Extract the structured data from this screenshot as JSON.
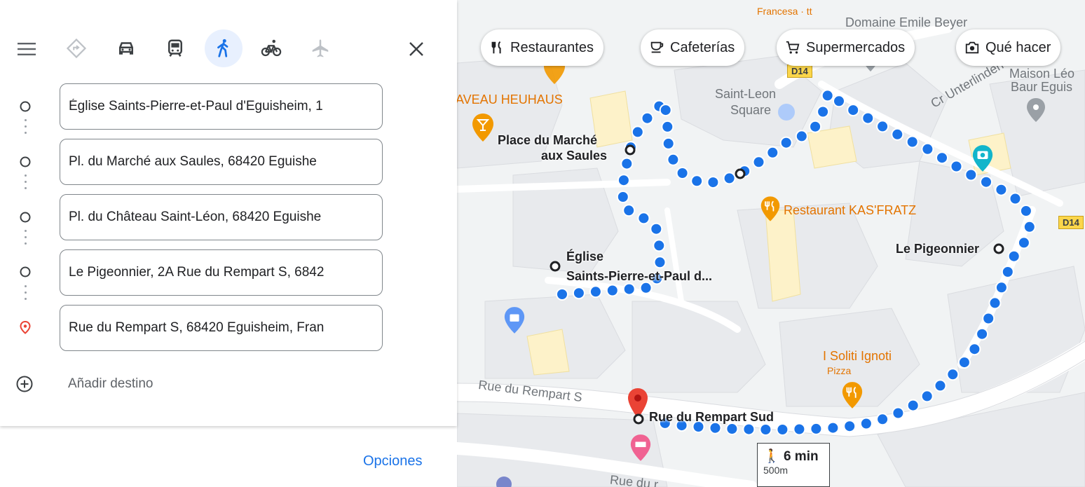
{
  "panel": {
    "menu_icon": "hamburger-menu-icon",
    "modes": [
      {
        "id": "best",
        "icon": "directions-diamond-icon",
        "active": false
      },
      {
        "id": "car",
        "icon": "car-icon",
        "active": false
      },
      {
        "id": "transit",
        "icon": "train-icon",
        "active": false
      },
      {
        "id": "walk",
        "icon": "walking-icon",
        "active": true
      },
      {
        "id": "bike",
        "icon": "bicycle-icon",
        "active": false
      },
      {
        "id": "flight",
        "icon": "airplane-icon",
        "active": false
      }
    ],
    "close_icon": "close-icon",
    "waypoints": [
      {
        "value": "Église Saints-Pierre-et-Paul d'Eguisheim, 1"
      },
      {
        "value": "Pl. du Marché aux Saules, 68420 Eguishe"
      },
      {
        "value": "Pl. du Château Saint-Léon, 68420 Eguishe"
      },
      {
        "value": "Le Pigeonnier, 2A Rue du Rempart S, 6842"
      },
      {
        "value": "Rue du Rempart S, 68420 Eguisheim, Fran"
      }
    ],
    "add_destination": "Añadir destino",
    "options": "Opciones"
  },
  "map": {
    "chips": [
      {
        "label": "Restaurantes",
        "icon": "fork-knife-icon"
      },
      {
        "label": "Cafeterías",
        "icon": "coffee-cup-icon"
      },
      {
        "label": "Supermercados",
        "icon": "shopping-cart-icon"
      },
      {
        "label": "Qué hacer",
        "icon": "camera-icon"
      }
    ],
    "labels": {
      "francesa": "Francesa · tt",
      "domaine": "Domaine Emile Beyer",
      "maison": "Maison Léo",
      "baur": "Baur Eguis",
      "caveau": "AVEAU HEUHAUS",
      "saint_leon": "Saint-Leon",
      "square": "Square",
      "cr_unterlinden": "Cr Unterlinden",
      "place_marche_1": "Place du Marché",
      "place_marche_2": "aux Saules",
      "restaurant": "Restaurant KAS'FRATZ",
      "pigeonnier": "Le Pigeonnier",
      "eglise_1": "Église",
      "eglise_2": "Saints-Pierre-et-Paul d...",
      "soliti": "I Soliti Ignoti",
      "pizza": "Pizza",
      "rue_rempart": "Rue du Rempart S",
      "rue_rempart_sud": "Rue du Rempart Sud",
      "rue_du": "Rue du r",
      "d14_a": "D14",
      "d14_b": "D14"
    },
    "route": {
      "time": "6 min",
      "distance": "500m"
    },
    "colors": {
      "route": "#1a73e8",
      "pin": "#ea4335",
      "poi_orange": "#f29900",
      "poi_teal": "#12b5cb",
      "poi_pink": "#f06292"
    }
  }
}
